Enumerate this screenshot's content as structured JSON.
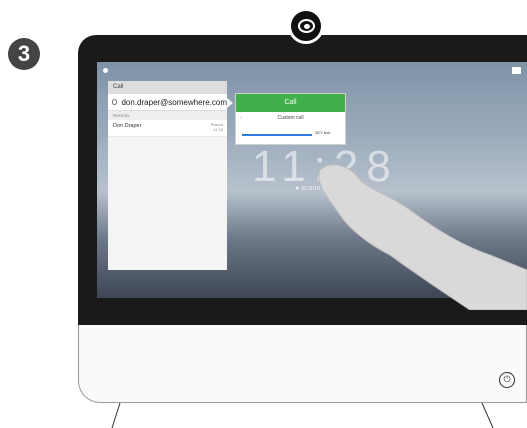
{
  "step": {
    "number": "3"
  },
  "panel": {
    "title": "Call",
    "search_value": "don.draper@somewhere.com",
    "section": "Recents",
    "contacts": [
      {
        "name": "Don Draper",
        "meta_line1": "Placed",
        "meta_line2": "11 28"
      }
    ]
  },
  "popup": {
    "call_label": "Call",
    "option_label": "Custom call",
    "bitrate_label": "3072 kb/s"
  },
  "screen": {
    "clock": "11:28",
    "location": "● acano"
  },
  "icons": {
    "camera": "camera-icon",
    "power": "power-icon",
    "search": "search-icon"
  },
  "colors": {
    "call_button": "#3fb04a",
    "slider": "#2f7de1"
  }
}
